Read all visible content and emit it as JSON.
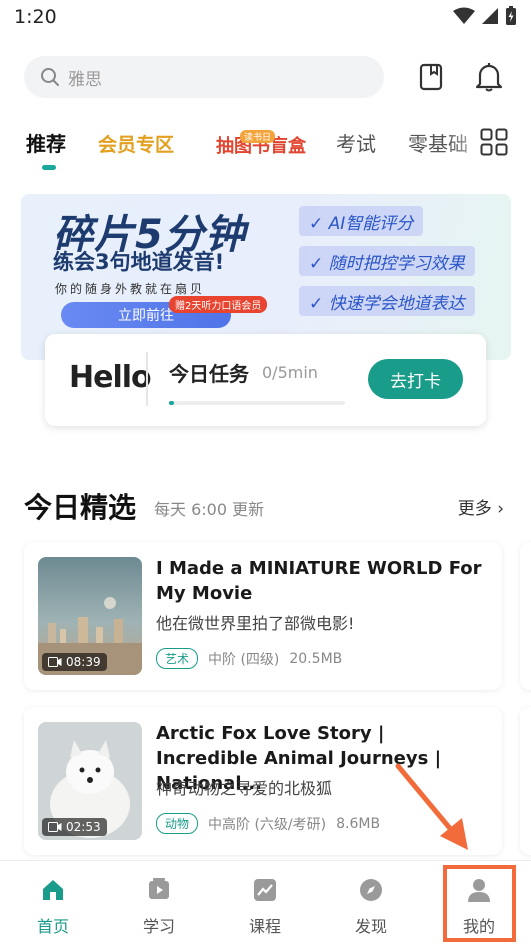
{
  "status_bar": {
    "time": "1:20"
  },
  "search": {
    "placeholder": "雅思"
  },
  "tabs": [
    {
      "label": "推荐"
    },
    {
      "label": "会员专区"
    },
    {
      "label": "抽图书盲盒",
      "badge": "读书日"
    },
    {
      "label": "考试"
    },
    {
      "label": "零基础"
    }
  ],
  "banner": {
    "title": "碎片5分钟",
    "subtitle": "练会3句地道发音!",
    "small": "你的随身外教就在扇贝",
    "cta": "立即前往",
    "gift": "赠2天听力口语会员",
    "features": [
      "✓ AI智能评分",
      "✓ 随时把控学习效果",
      "✓ 快速学会地道表达"
    ]
  },
  "task_card": {
    "hello": "Hello",
    "label": "今日任务",
    "progress_text": "0/5min",
    "progress": 0.03,
    "button": "去打卡"
  },
  "section": {
    "title": "今日精选",
    "subtitle": "每天 6:00 更新",
    "more": "更多 ›"
  },
  "videos": [
    {
      "title": "I Made a MINIATURE WORLD For My Movie",
      "zh": "他在微世界里拍了部微电影!",
      "duration": "08:39",
      "tag": "艺术",
      "level": "中阶 (四级)",
      "size": "20.5MB"
    },
    {
      "title": "Arctic Fox Love Story | Incredible Animal Journeys | National...",
      "zh": "神奇动物之寻爱的北极狐",
      "duration": "02:53",
      "tag": "动物",
      "level": "中高阶 (六级/考研)",
      "size": "8.6MB"
    }
  ],
  "bottom_nav": [
    {
      "label": "首页"
    },
    {
      "label": "学习"
    },
    {
      "label": "课程"
    },
    {
      "label": "发现"
    },
    {
      "label": "我的"
    }
  ],
  "colors": {
    "accent": "#1a9c8a",
    "highlight": "#f26b3a"
  }
}
